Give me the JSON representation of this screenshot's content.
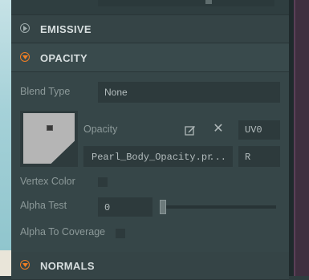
{
  "sections": {
    "emissive": {
      "title": "EMISSIVE"
    },
    "opacity": {
      "title": "OPACITY"
    },
    "normals": {
      "title": "NORMALS"
    }
  },
  "opacity": {
    "blend_type_label": "Blend Type",
    "blend_type_value": "None",
    "opacity_label": "Opacity",
    "uv_channel": "UV0",
    "texture_file": "Pearl_Body_Opacity.pr",
    "file_menu": "...",
    "color_channel": "R",
    "vertex_color_label": "Vertex Color",
    "alpha_test_label": "Alpha Test",
    "alpha_test_value": "0",
    "alpha_to_coverage_label": "Alpha To Coverage"
  },
  "colors": {
    "accent": "#f07e24",
    "panel": "#364648",
    "field": "#2d3a3c"
  }
}
